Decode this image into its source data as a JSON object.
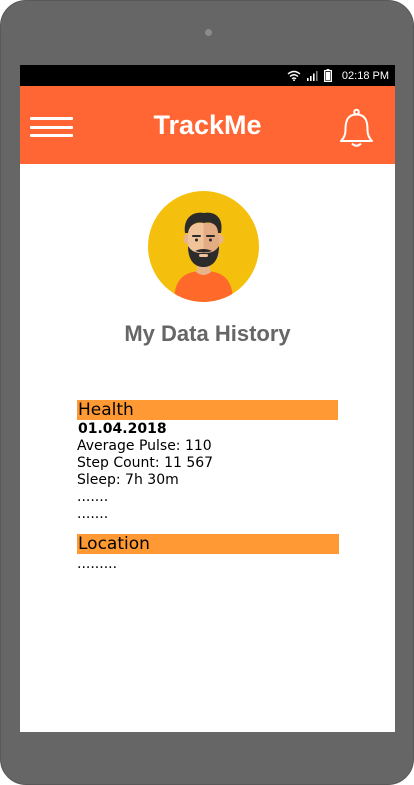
{
  "status_bar": {
    "time": "02:18 PM",
    "icons": [
      "wifi-icon",
      "signal-icon",
      "battery-icon"
    ]
  },
  "app_bar": {
    "title": "TrackMe",
    "menu_icon": "hamburger-menu-icon",
    "notification_icon": "bell-icon",
    "color": "#ff6633"
  },
  "profile": {
    "avatar_icon": "user-avatar-icon",
    "page_title": "My Data History"
  },
  "health": {
    "header": "Health",
    "date": "01.04.2018",
    "lines": [
      "Average Pulse: 110",
      "Step Count: 11 567",
      "Sleep: 7h 30m",
      ".......",
      "......."
    ]
  },
  "location": {
    "header": "Location",
    "placeholder": "........."
  },
  "colors": {
    "accent": "#ff6633",
    "section_header": "#ff9933",
    "title_text": "#666666",
    "device_frame": "#666666"
  }
}
